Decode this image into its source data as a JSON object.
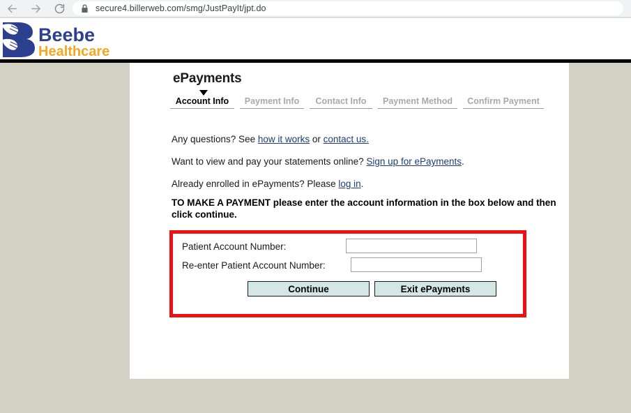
{
  "browser": {
    "back_icon": "back-arrow-icon",
    "forward_icon": "forward-arrow-icon",
    "reload_icon": "reload-icon",
    "lock_icon": "lock-icon",
    "url": "secure4.billerweb.com/smg/JustPayIt/jpt.do"
  },
  "site": {
    "logo_name": "beebe-healthcare-logo",
    "logo_primary_text": "Beebe",
    "logo_secondary_text": "Healthcare",
    "logo_blue": "#2d3f8f",
    "logo_gold": "#f5a623"
  },
  "page": {
    "title": "ePayments",
    "steps": [
      {
        "label": "Account Info",
        "active": true
      },
      {
        "label": "Payment Info",
        "active": false
      },
      {
        "label": "Contact Info",
        "active": false
      },
      {
        "label": "Payment Method",
        "active": false
      },
      {
        "label": "Confirm Payment",
        "active": false
      }
    ],
    "paragraphs": {
      "questions_prefix": "Any questions? See ",
      "questions_link1": "how it works",
      "questions_middle": " or ",
      "questions_link2": "contact us.",
      "signup_prefix": "Want to view and pay your statements online? ",
      "signup_link": "Sign up for ePayments",
      "signup_suffix": ".",
      "login_prefix": "Already enrolled in ePayments? Please ",
      "login_link": "log in",
      "login_suffix": "."
    },
    "instruction": "TO MAKE A PAYMENT please enter the account information in the box below and then click continue."
  },
  "form": {
    "border_color": "#ee1111",
    "account_label": "Patient Account Number:",
    "account_value": "",
    "reenter_label": "Re-enter Patient Account Number:",
    "reenter_value": "",
    "continue_label": "Continue",
    "exit_label": "Exit ePayments",
    "button_color": "#d5e6e6"
  }
}
